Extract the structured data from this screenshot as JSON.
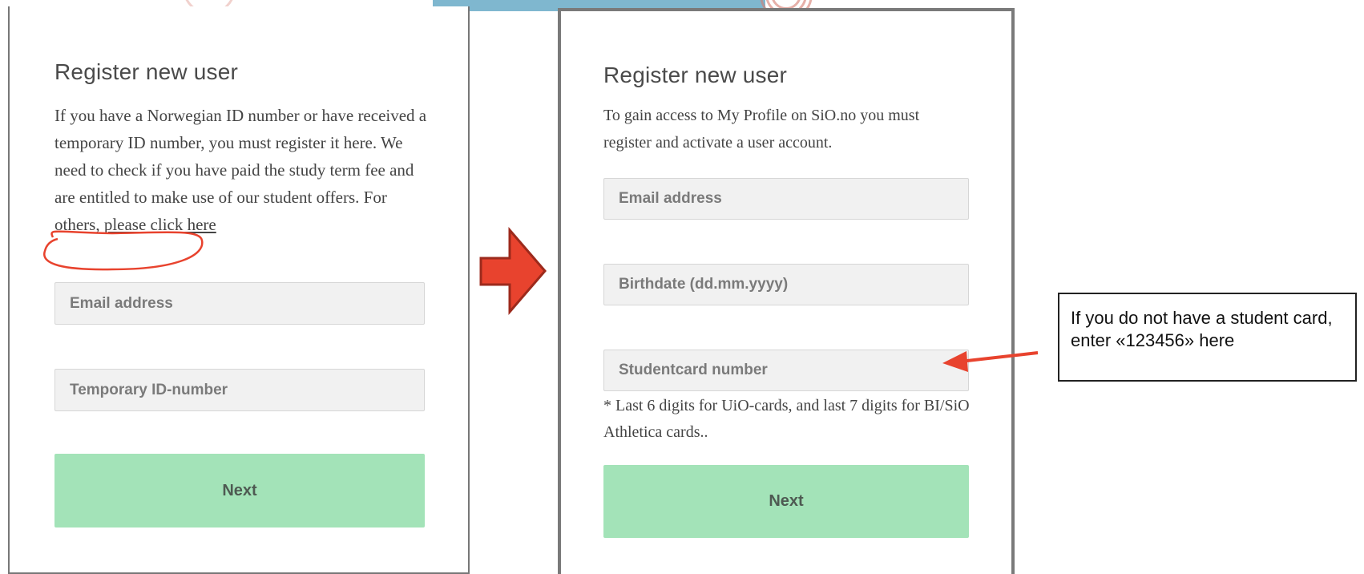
{
  "colors": {
    "next_button": "#a3e3b8",
    "field_background": "#f1f1f1",
    "annotation_red": "#e8432e",
    "flow_arrow": "#e8432e"
  },
  "left_form": {
    "heading": "Register new user",
    "intro": "If you have a Norwegian ID number or have received a temporary ID number, you must register it here. We need to check if you have paid the study term fee and are entitled to make use of our student offers. For others,",
    "link": "please click here",
    "email_placeholder": "Email address",
    "temp_id_placeholder": "Temporary ID-number",
    "next_label": "Next"
  },
  "right_form": {
    "heading": "Register new user",
    "intro": "To gain access to My Profile on SiO.no you must register and activate a user account.",
    "email_placeholder": "Email address",
    "birthdate_placeholder": "Birthdate (dd.mm.yyyy)",
    "studentcard_placeholder": "Studentcard number",
    "studentcard_note": "* Last 6 digits for UiO-cards, and last 7 digits for BI/SiO Athletica cards..",
    "next_label": "Next"
  },
  "callout": {
    "text": "If you do not have a student card, enter «123456» here"
  },
  "icons": {
    "flow_arrow": "right-block-arrow-icon",
    "callout_arrow": "left-pointer-arrow-icon",
    "link_circle": "highlight-circle"
  }
}
